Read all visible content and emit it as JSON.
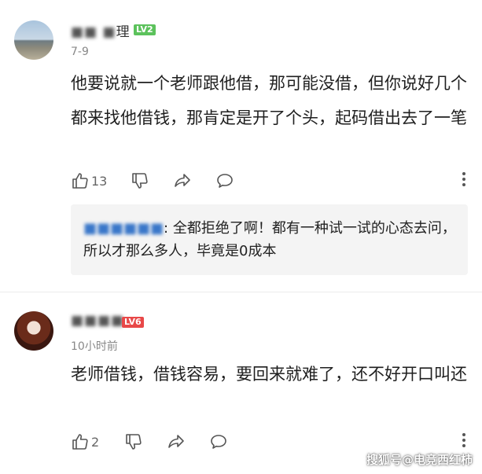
{
  "comments": [
    {
      "username": "理",
      "username_blurred": "■■ ■",
      "level": "LV2",
      "level_color": "#5cc25c",
      "time": "7-9",
      "body": "他要说就一个老师跟他借，那可能没借，但你说好几个都来找他借钱，那肯定是开了个头，起码借出去了一笔",
      "likes": "13",
      "reply": {
        "name": "■■■■■■",
        "text": ": 全都拒绝了啊！都有一种试一试的心态去问，所以才那么多人，毕竟是0成本"
      }
    },
    {
      "username": "",
      "username_blurred": "■■■■",
      "level": "LV6",
      "level_color": "#e84848",
      "time": "10小时前",
      "body": "老师借钱，借钱容易，要回来就难了，还不好开口叫还",
      "likes": "2"
    }
  ],
  "icons": [
    "thumb-up-icon",
    "thumb-down-icon",
    "share-icon",
    "comment-icon",
    "more-icon"
  ],
  "accent_color": "#3a77c9",
  "watermark": "搜狐号@电竞西红柿"
}
